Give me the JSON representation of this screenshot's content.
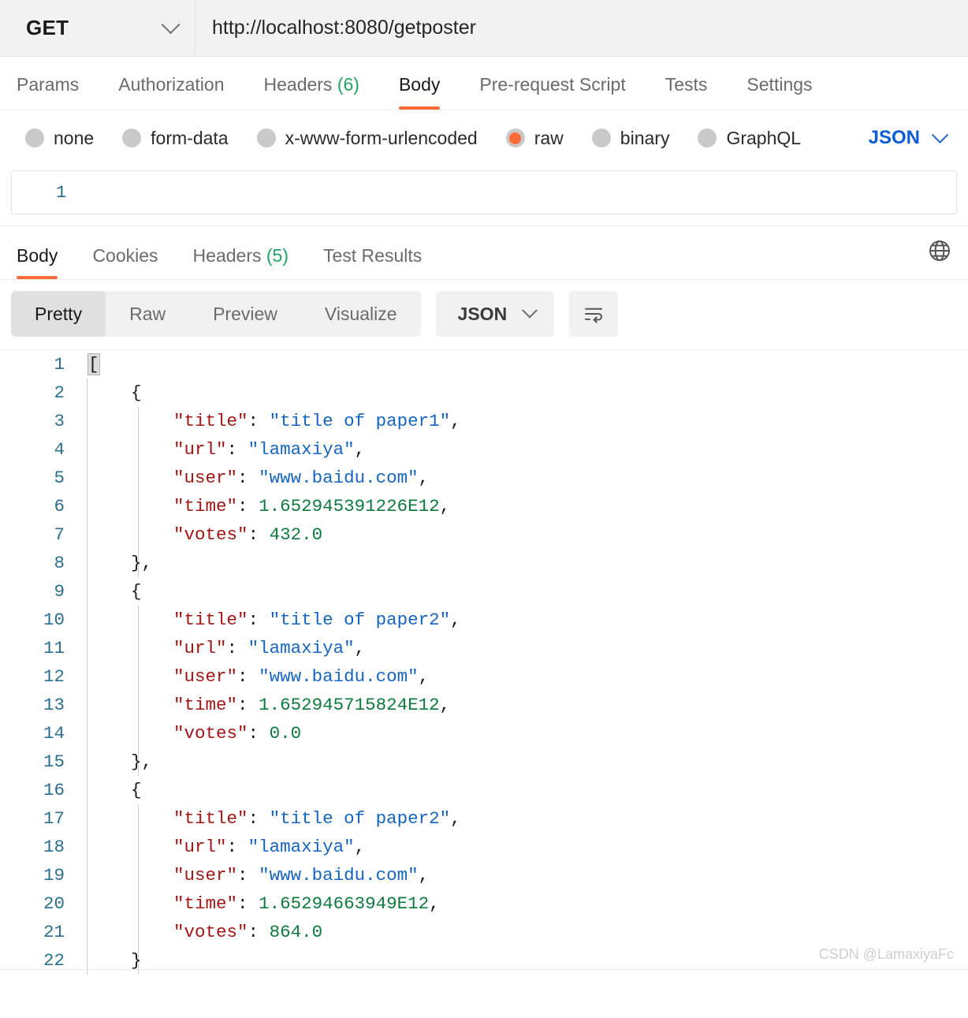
{
  "request": {
    "method": "GET",
    "url": "http://localhost:8080/getposter",
    "method_chevron_icon": "chevron-down-icon",
    "tabs": [
      {
        "label": "Params",
        "active": false
      },
      {
        "label": "Authorization",
        "active": false
      },
      {
        "label": "Headers",
        "count": "(6)",
        "active": false
      },
      {
        "label": "Body",
        "active": true
      },
      {
        "label": "Pre-request Script",
        "active": false
      },
      {
        "label": "Tests",
        "active": false
      },
      {
        "label": "Settings",
        "active": false
      }
    ],
    "body_types": [
      {
        "label": "none",
        "checked": false
      },
      {
        "label": "form-data",
        "checked": false
      },
      {
        "label": "x-www-form-urlencoded",
        "checked": false
      },
      {
        "label": "raw",
        "checked": true
      },
      {
        "label": "binary",
        "checked": false
      },
      {
        "label": "GraphQL",
        "checked": false
      }
    ],
    "raw_format": "JSON",
    "raw_format_chevron_icon": "chevron-down-icon",
    "editor_line_number": "1",
    "editor_value": ""
  },
  "response": {
    "tabs": [
      {
        "label": "Body",
        "active": true
      },
      {
        "label": "Cookies",
        "active": false
      },
      {
        "label": "Headers",
        "count": "(5)",
        "active": false
      },
      {
        "label": "Test Results",
        "active": false
      }
    ],
    "globe_icon": "globe-icon",
    "view_modes": [
      {
        "label": "Pretty",
        "active": true
      },
      {
        "label": "Raw",
        "active": false
      },
      {
        "label": "Preview",
        "active": false
      },
      {
        "label": "Visualize",
        "active": false
      }
    ],
    "format": "JSON",
    "format_chevron_icon": "chevron-down-icon",
    "wrap_icon": "word-wrap-icon",
    "code_lines": [
      {
        "n": "1",
        "indent": 0,
        "tokens": [
          {
            "t": "punct",
            "v": "[",
            "hl": true
          }
        ]
      },
      {
        "n": "2",
        "indent": 1,
        "tokens": [
          {
            "t": "punct",
            "v": "{"
          }
        ]
      },
      {
        "n": "3",
        "indent": 2,
        "tokens": [
          {
            "t": "key",
            "v": "\"title\""
          },
          {
            "t": "punct",
            "v": ": "
          },
          {
            "t": "str",
            "v": "\"title of paper1\""
          },
          {
            "t": "punct",
            "v": ","
          }
        ]
      },
      {
        "n": "4",
        "indent": 2,
        "tokens": [
          {
            "t": "key",
            "v": "\"url\""
          },
          {
            "t": "punct",
            "v": ": "
          },
          {
            "t": "str",
            "v": "\"lamaxiya\""
          },
          {
            "t": "punct",
            "v": ","
          }
        ]
      },
      {
        "n": "5",
        "indent": 2,
        "tokens": [
          {
            "t": "key",
            "v": "\"user\""
          },
          {
            "t": "punct",
            "v": ": "
          },
          {
            "t": "str",
            "v": "\"www.baidu.com\""
          },
          {
            "t": "punct",
            "v": ","
          }
        ]
      },
      {
        "n": "6",
        "indent": 2,
        "tokens": [
          {
            "t": "key",
            "v": "\"time\""
          },
          {
            "t": "punct",
            "v": ": "
          },
          {
            "t": "num",
            "v": "1.652945391226E12"
          },
          {
            "t": "punct",
            "v": ","
          }
        ]
      },
      {
        "n": "7",
        "indent": 2,
        "tokens": [
          {
            "t": "key",
            "v": "\"votes\""
          },
          {
            "t": "punct",
            "v": ": "
          },
          {
            "t": "num",
            "v": "432.0"
          }
        ]
      },
      {
        "n": "8",
        "indent": 1,
        "tokens": [
          {
            "t": "punct",
            "v": "},"
          }
        ]
      },
      {
        "n": "9",
        "indent": 1,
        "tokens": [
          {
            "t": "punct",
            "v": "{"
          }
        ]
      },
      {
        "n": "10",
        "indent": 2,
        "tokens": [
          {
            "t": "key",
            "v": "\"title\""
          },
          {
            "t": "punct",
            "v": ": "
          },
          {
            "t": "str",
            "v": "\"title of paper2\""
          },
          {
            "t": "punct",
            "v": ","
          }
        ]
      },
      {
        "n": "11",
        "indent": 2,
        "tokens": [
          {
            "t": "key",
            "v": "\"url\""
          },
          {
            "t": "punct",
            "v": ": "
          },
          {
            "t": "str",
            "v": "\"lamaxiya\""
          },
          {
            "t": "punct",
            "v": ","
          }
        ]
      },
      {
        "n": "12",
        "indent": 2,
        "tokens": [
          {
            "t": "key",
            "v": "\"user\""
          },
          {
            "t": "punct",
            "v": ": "
          },
          {
            "t": "str",
            "v": "\"www.baidu.com\""
          },
          {
            "t": "punct",
            "v": ","
          }
        ]
      },
      {
        "n": "13",
        "indent": 2,
        "tokens": [
          {
            "t": "key",
            "v": "\"time\""
          },
          {
            "t": "punct",
            "v": ": "
          },
          {
            "t": "num",
            "v": "1.652945715824E12"
          },
          {
            "t": "punct",
            "v": ","
          }
        ]
      },
      {
        "n": "14",
        "indent": 2,
        "tokens": [
          {
            "t": "key",
            "v": "\"votes\""
          },
          {
            "t": "punct",
            "v": ": "
          },
          {
            "t": "num",
            "v": "0.0"
          }
        ]
      },
      {
        "n": "15",
        "indent": 1,
        "tokens": [
          {
            "t": "punct",
            "v": "},"
          }
        ]
      },
      {
        "n": "16",
        "indent": 1,
        "tokens": [
          {
            "t": "punct",
            "v": "{"
          }
        ]
      },
      {
        "n": "17",
        "indent": 2,
        "tokens": [
          {
            "t": "key",
            "v": "\"title\""
          },
          {
            "t": "punct",
            "v": ": "
          },
          {
            "t": "str",
            "v": "\"title of paper2\""
          },
          {
            "t": "punct",
            "v": ","
          }
        ]
      },
      {
        "n": "18",
        "indent": 2,
        "tokens": [
          {
            "t": "key",
            "v": "\"url\""
          },
          {
            "t": "punct",
            "v": ": "
          },
          {
            "t": "str",
            "v": "\"lamaxiya\""
          },
          {
            "t": "punct",
            "v": ","
          }
        ]
      },
      {
        "n": "19",
        "indent": 2,
        "tokens": [
          {
            "t": "key",
            "v": "\"user\""
          },
          {
            "t": "punct",
            "v": ": "
          },
          {
            "t": "str",
            "v": "\"www.baidu.com\""
          },
          {
            "t": "punct",
            "v": ","
          }
        ]
      },
      {
        "n": "20",
        "indent": 2,
        "tokens": [
          {
            "t": "key",
            "v": "\"time\""
          },
          {
            "t": "punct",
            "v": ": "
          },
          {
            "t": "num",
            "v": "1.65294663949E12"
          },
          {
            "t": "punct",
            "v": ","
          }
        ]
      },
      {
        "n": "21",
        "indent": 2,
        "tokens": [
          {
            "t": "key",
            "v": "\"votes\""
          },
          {
            "t": "punct",
            "v": ": "
          },
          {
            "t": "num",
            "v": "864.0"
          }
        ]
      },
      {
        "n": "22",
        "indent": 1,
        "tokens": [
          {
            "t": "punct",
            "v": "}"
          }
        ]
      }
    ]
  },
  "watermark": "CSDN @LamaxiyaFc",
  "colors": {
    "accent_orange": "#ff6c37",
    "count_green": "#21a366",
    "link_blue": "#0b5cd5",
    "json_key": "#a31515",
    "json_string": "#1565c0",
    "json_number": "#0d7a3e",
    "gutter": "#2c6f8c"
  }
}
